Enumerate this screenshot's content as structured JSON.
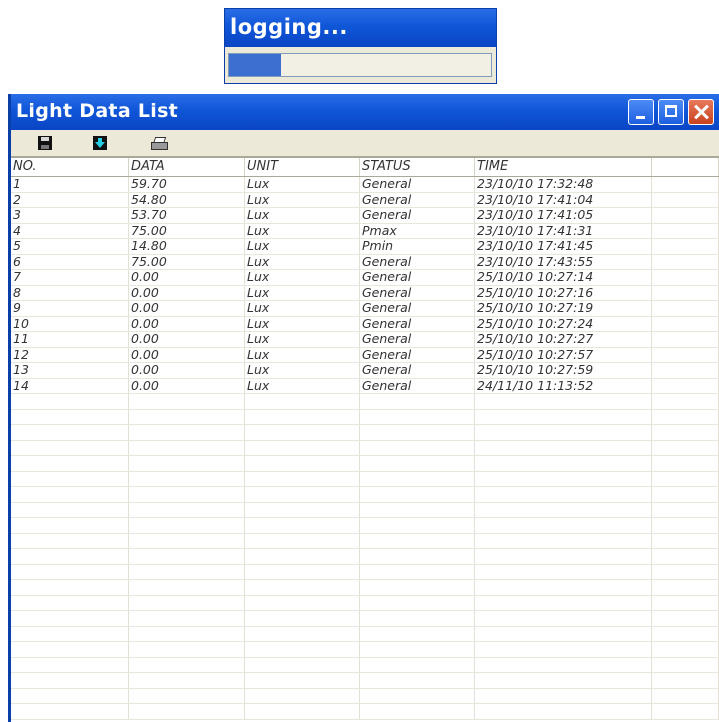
{
  "logging_dialog": {
    "title": "logging...",
    "progress": 0.2
  },
  "window": {
    "title": "Light Data List"
  },
  "toolbar": {
    "icons": [
      "save-icon",
      "download-icon",
      "print-icon"
    ]
  },
  "table": {
    "columns": [
      "NO.",
      "DATA",
      "UNIT",
      "STATUS",
      "TIME",
      ""
    ],
    "rows": [
      [
        "1",
        "59.70",
        "Lux",
        "General",
        "23/10/10 17:32:48"
      ],
      [
        "2",
        "54.80",
        "Lux",
        "General",
        "23/10/10 17:41:04"
      ],
      [
        "3",
        "53.70",
        "Lux",
        "General",
        "23/10/10 17:41:05"
      ],
      [
        "4",
        "75.00",
        "Lux",
        "Pmax",
        "23/10/10 17:41:31"
      ],
      [
        "5",
        "14.80",
        "Lux",
        "Pmin",
        "23/10/10 17:41:45"
      ],
      [
        "6",
        "75.00",
        "Lux",
        "General",
        "23/10/10 17:43:55"
      ],
      [
        "7",
        "0.00",
        "Lux",
        "General",
        "25/10/10 10:27:14"
      ],
      [
        "8",
        "0.00",
        "Lux",
        "General",
        "25/10/10 10:27:16"
      ],
      [
        "9",
        "0.00",
        "Lux",
        "General",
        "25/10/10 10:27:19"
      ],
      [
        "10",
        "0.00",
        "Lux",
        "General",
        "25/10/10 10:27:24"
      ],
      [
        "11",
        "0.00",
        "Lux",
        "General",
        "25/10/10 10:27:27"
      ],
      [
        "12",
        "0.00",
        "Lux",
        "General",
        "25/10/10 10:27:57"
      ],
      [
        "13",
        "0.00",
        "Lux",
        "General",
        "25/10/10 10:27:59"
      ],
      [
        "14",
        "0.00",
        "Lux",
        "General",
        "24/11/10 11:13:52"
      ]
    ]
  },
  "colors": {
    "titlebar": "#0f56d8",
    "progress_fill": "#3c6fd0",
    "close_button": "#c8421e"
  }
}
